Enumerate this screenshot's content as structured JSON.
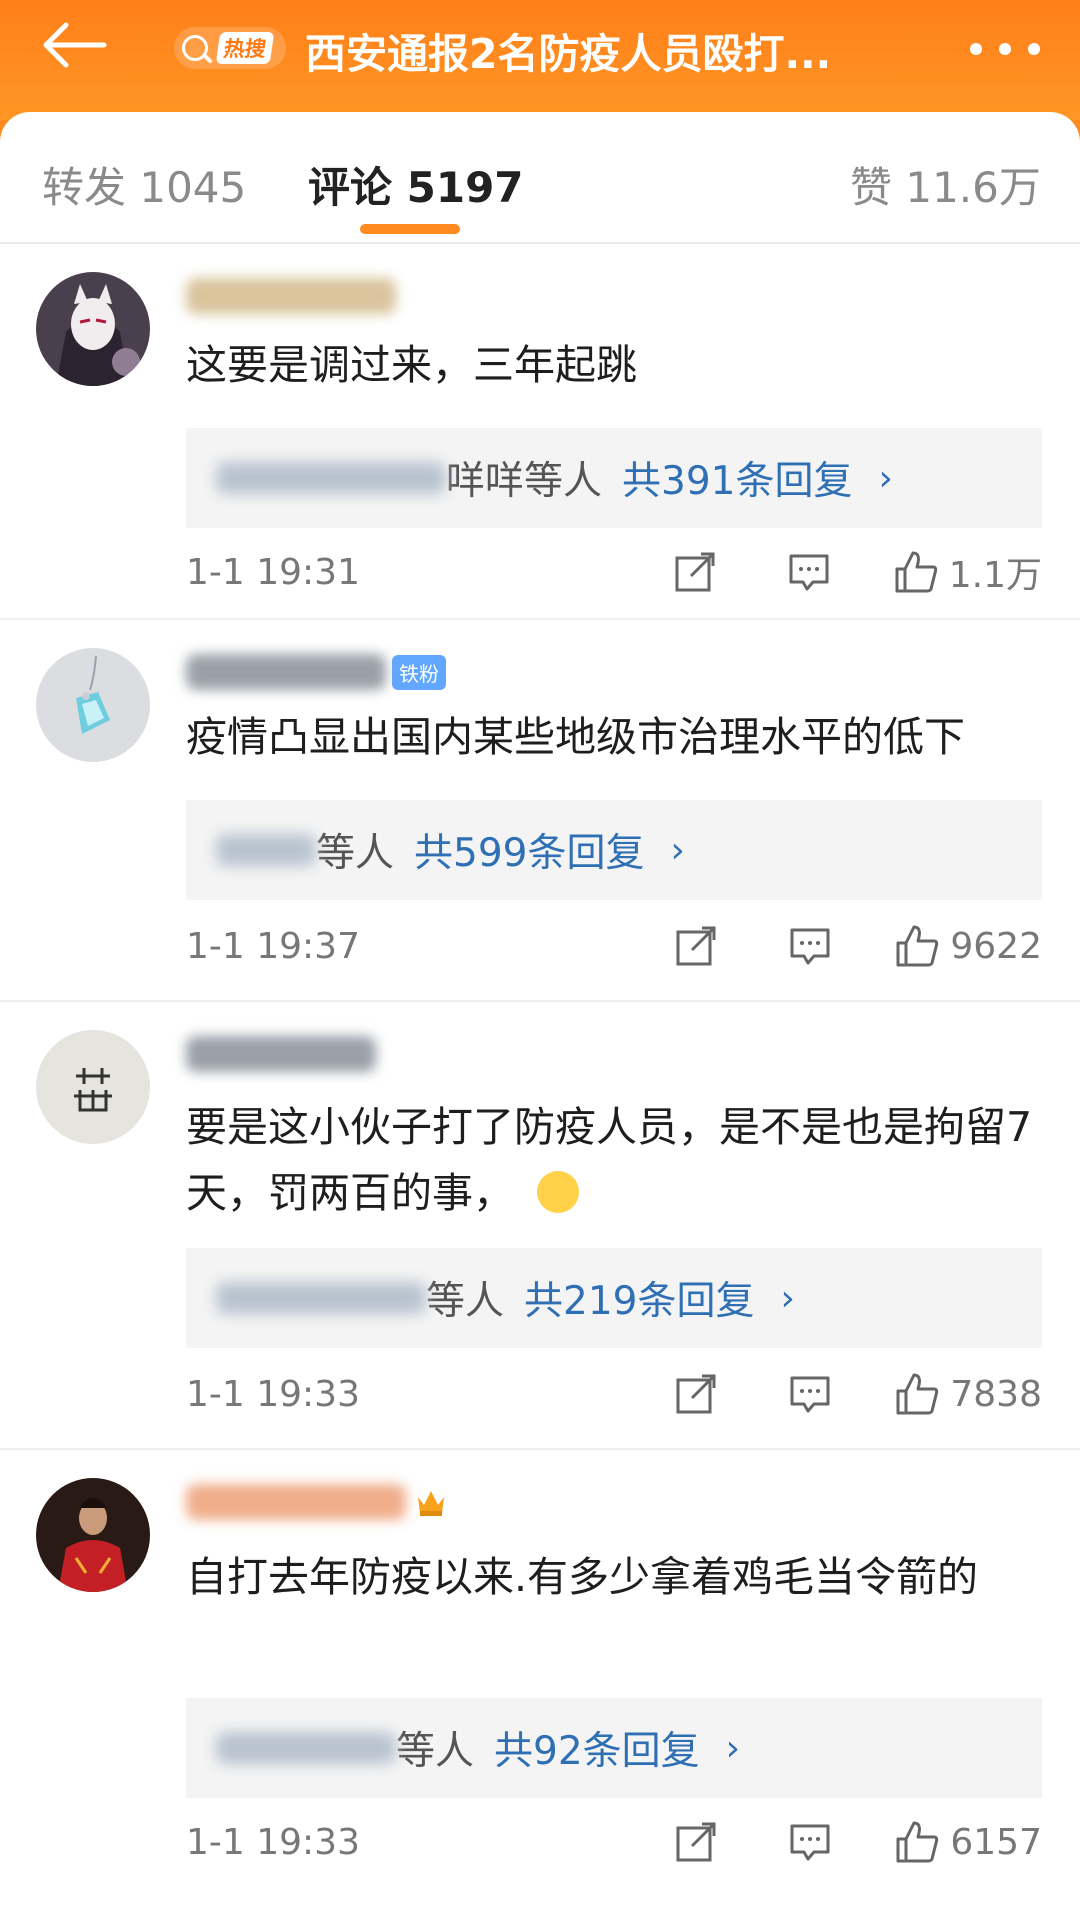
{
  "header": {
    "hot_label": "热搜",
    "title": "西安通报2名防疫人员殴打..."
  },
  "tabs": [
    {
      "label": "转发 1045"
    },
    {
      "label": "评论 5197"
    },
    {
      "label": "赞 11.6万"
    }
  ],
  "comments": [
    {
      "text": "这要是调过来，三年起跳",
      "reply_tail": "咩咩等人",
      "reply_count": "共391条回复",
      "time": "1-1 19:31",
      "likes": "1.1万"
    },
    {
      "badge": "铁粉",
      "text": "疫情凸显出国内某些地级市治理水平的低下",
      "reply_tail": "等人",
      "reply_count": "共599条回复",
      "time": "1-1 19:37",
      "likes": "9622"
    },
    {
      "text": "要是这小伙子打了防疫人员，是不是也是拘留7天，罚两百的事，",
      "reply_tail": "等人",
      "reply_count": "共219条回复",
      "time": "1-1 19:33",
      "likes": "7838"
    },
    {
      "text": "自打去年防疫以来.有多少拿着鸡毛当令箭的",
      "reply_tail": "等人",
      "reply_count": "共92条回复",
      "time": "1-1 19:33",
      "likes": "6157"
    }
  ],
  "icons": {
    "back": "back-arrow-icon",
    "search": "search-icon",
    "more": "more-dots-icon",
    "share": "share-icon",
    "comment": "comment-icon",
    "like": "thumb-up-icon"
  },
  "colors": {
    "brand_orange": "#ff8a1f",
    "link_blue": "#2f6fb3",
    "fan_badge": "#61a7ff"
  }
}
